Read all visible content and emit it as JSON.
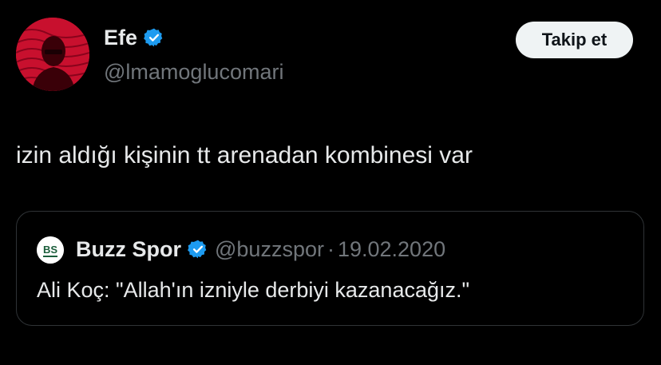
{
  "author": {
    "name": "Efe",
    "handle": "@lmamoglucomari",
    "verified": true,
    "avatar_color": "#c8102e"
  },
  "follow_button": {
    "label": "Takip et"
  },
  "tweet": {
    "text": "izin aldığı kişinin tt arenadan kombinesi var"
  },
  "quoted_tweet": {
    "avatar_text": "BS",
    "name": "Buzz Spor",
    "handle": "@buzzspor",
    "separator": "·",
    "date": "19.02.2020",
    "text": "Ali Koç: \"Allah'ın izniyle derbiyi kazanacağız.\"",
    "verified": true
  },
  "colors": {
    "background": "#000000",
    "primary_text": "#e7e9ea",
    "secondary_text": "#71767b",
    "verified_blue": "#1d9bf0",
    "border": "#2f3336",
    "button_bg": "#eff3f4"
  }
}
